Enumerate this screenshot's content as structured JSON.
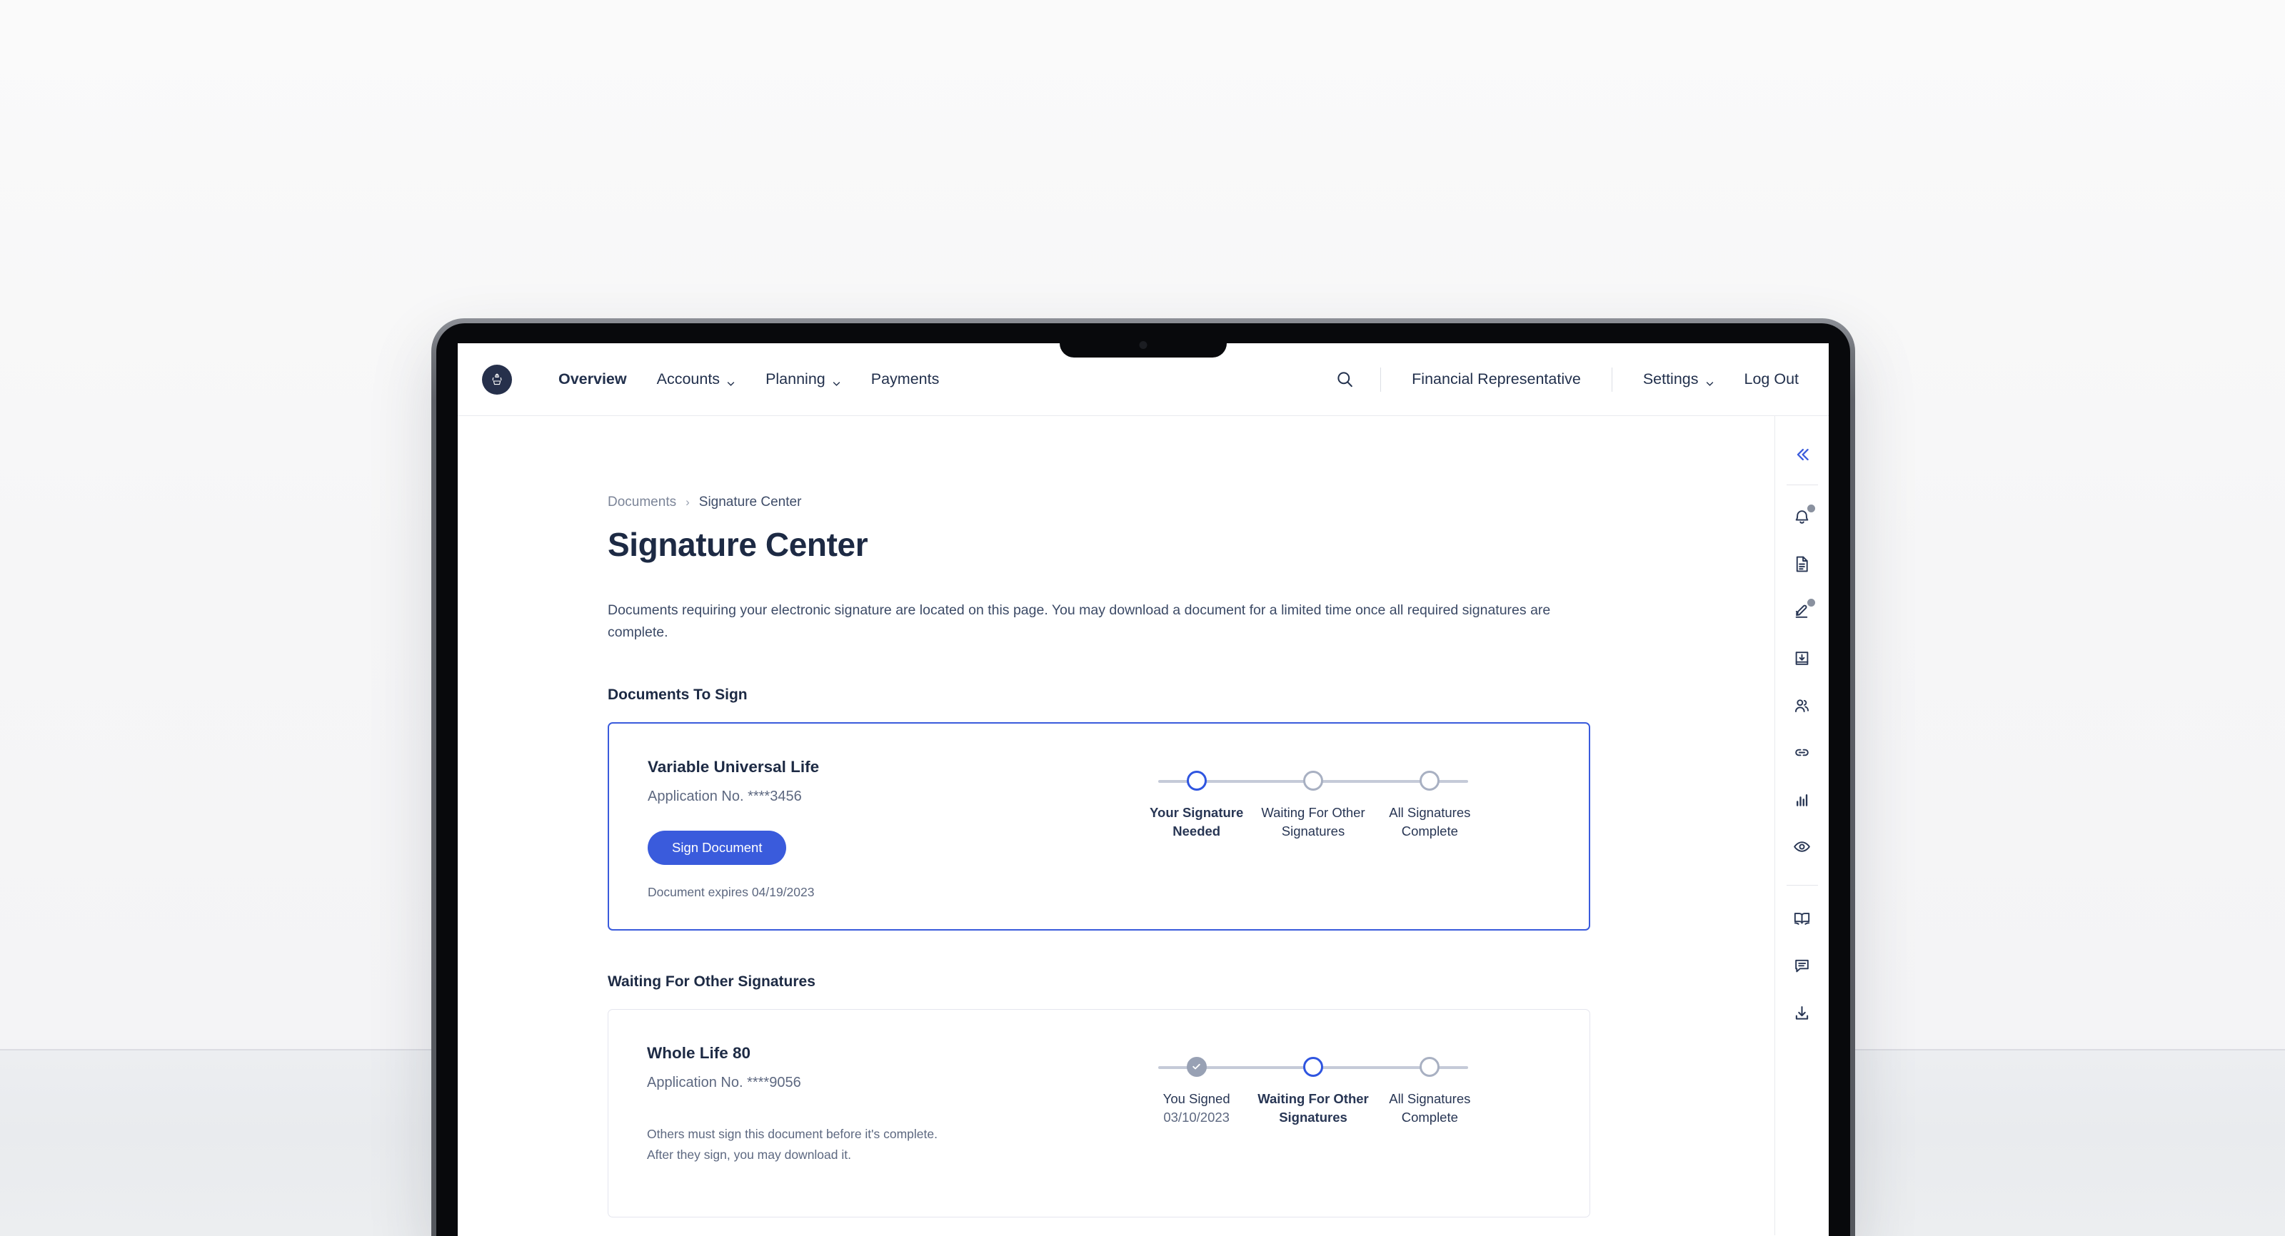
{
  "nav": {
    "logo_icon": "brand-crest-icon",
    "items": [
      {
        "label": "Overview",
        "has_chevron": false,
        "active": true
      },
      {
        "label": "Accounts",
        "has_chevron": true,
        "active": false
      },
      {
        "label": "Planning",
        "has_chevron": true,
        "active": false
      },
      {
        "label": "Payments",
        "has_chevron": false,
        "active": false
      }
    ],
    "search_icon": "search-icon",
    "right_items": [
      {
        "label": "Financial Representative",
        "has_chevron": false
      },
      {
        "label": "Settings",
        "has_chevron": true
      },
      {
        "label": "Log Out",
        "has_chevron": false
      }
    ]
  },
  "breadcrumb": {
    "parent": "Documents",
    "separator": "›",
    "current": "Signature Center"
  },
  "page": {
    "title": "Signature Center",
    "intro": "Documents requiring your electronic signature are located on this page. You may download a document for a limited time once all required signatures are complete."
  },
  "sections": [
    {
      "heading": "Documents To Sign",
      "card": {
        "state": "primary",
        "name": "Variable Universal Life",
        "application": "Application No. ****3456",
        "button": "Sign Document",
        "note": "Document expires 04/19/2023",
        "steps": [
          {
            "label": "Your Signature Needed",
            "state": "active",
            "date": ""
          },
          {
            "label": "Waiting For Other Signatures",
            "state": "todo",
            "date": ""
          },
          {
            "label": "All Signatures Complete",
            "state": "todo",
            "date": ""
          }
        ]
      }
    },
    {
      "heading": "Waiting For Other Signatures",
      "card": {
        "state": "muted",
        "name": "Whole Life 80",
        "application": "Application No. ****9056",
        "note_line_1": "Others must sign this document before it's complete.",
        "note_line_2": "After they sign, you may download it.",
        "steps": [
          {
            "label": "You Signed",
            "state": "done",
            "date": "03/10/2023"
          },
          {
            "label": "Waiting For Other Signatures",
            "state": "active",
            "date": ""
          },
          {
            "label": "All Signatures Complete",
            "state": "todo",
            "date": ""
          }
        ]
      }
    }
  ],
  "rail": {
    "collapse_icon": "chevrons-left-icon",
    "items": [
      {
        "icon": "bell-icon",
        "badge": true
      },
      {
        "icon": "document-icon",
        "badge": false
      },
      {
        "icon": "signature-pen-icon",
        "badge": true
      },
      {
        "icon": "inbox-download-icon",
        "badge": false
      },
      {
        "icon": "people-icon",
        "badge": false
      },
      {
        "icon": "link-icon",
        "badge": false
      },
      {
        "icon": "bar-chart-icon",
        "badge": false
      },
      {
        "icon": "eye-icon",
        "badge": false
      }
    ],
    "items_lower": [
      {
        "icon": "book-icon",
        "badge": false
      },
      {
        "icon": "chat-icon",
        "badge": false
      },
      {
        "icon": "download-icon",
        "badge": false
      }
    ]
  },
  "colors": {
    "accent": "#3a5bdc",
    "ink": "#1d2a44",
    "muted": "#5d6880",
    "step_inactive": "#a8b0c2",
    "step_done": "#98a1b4"
  }
}
